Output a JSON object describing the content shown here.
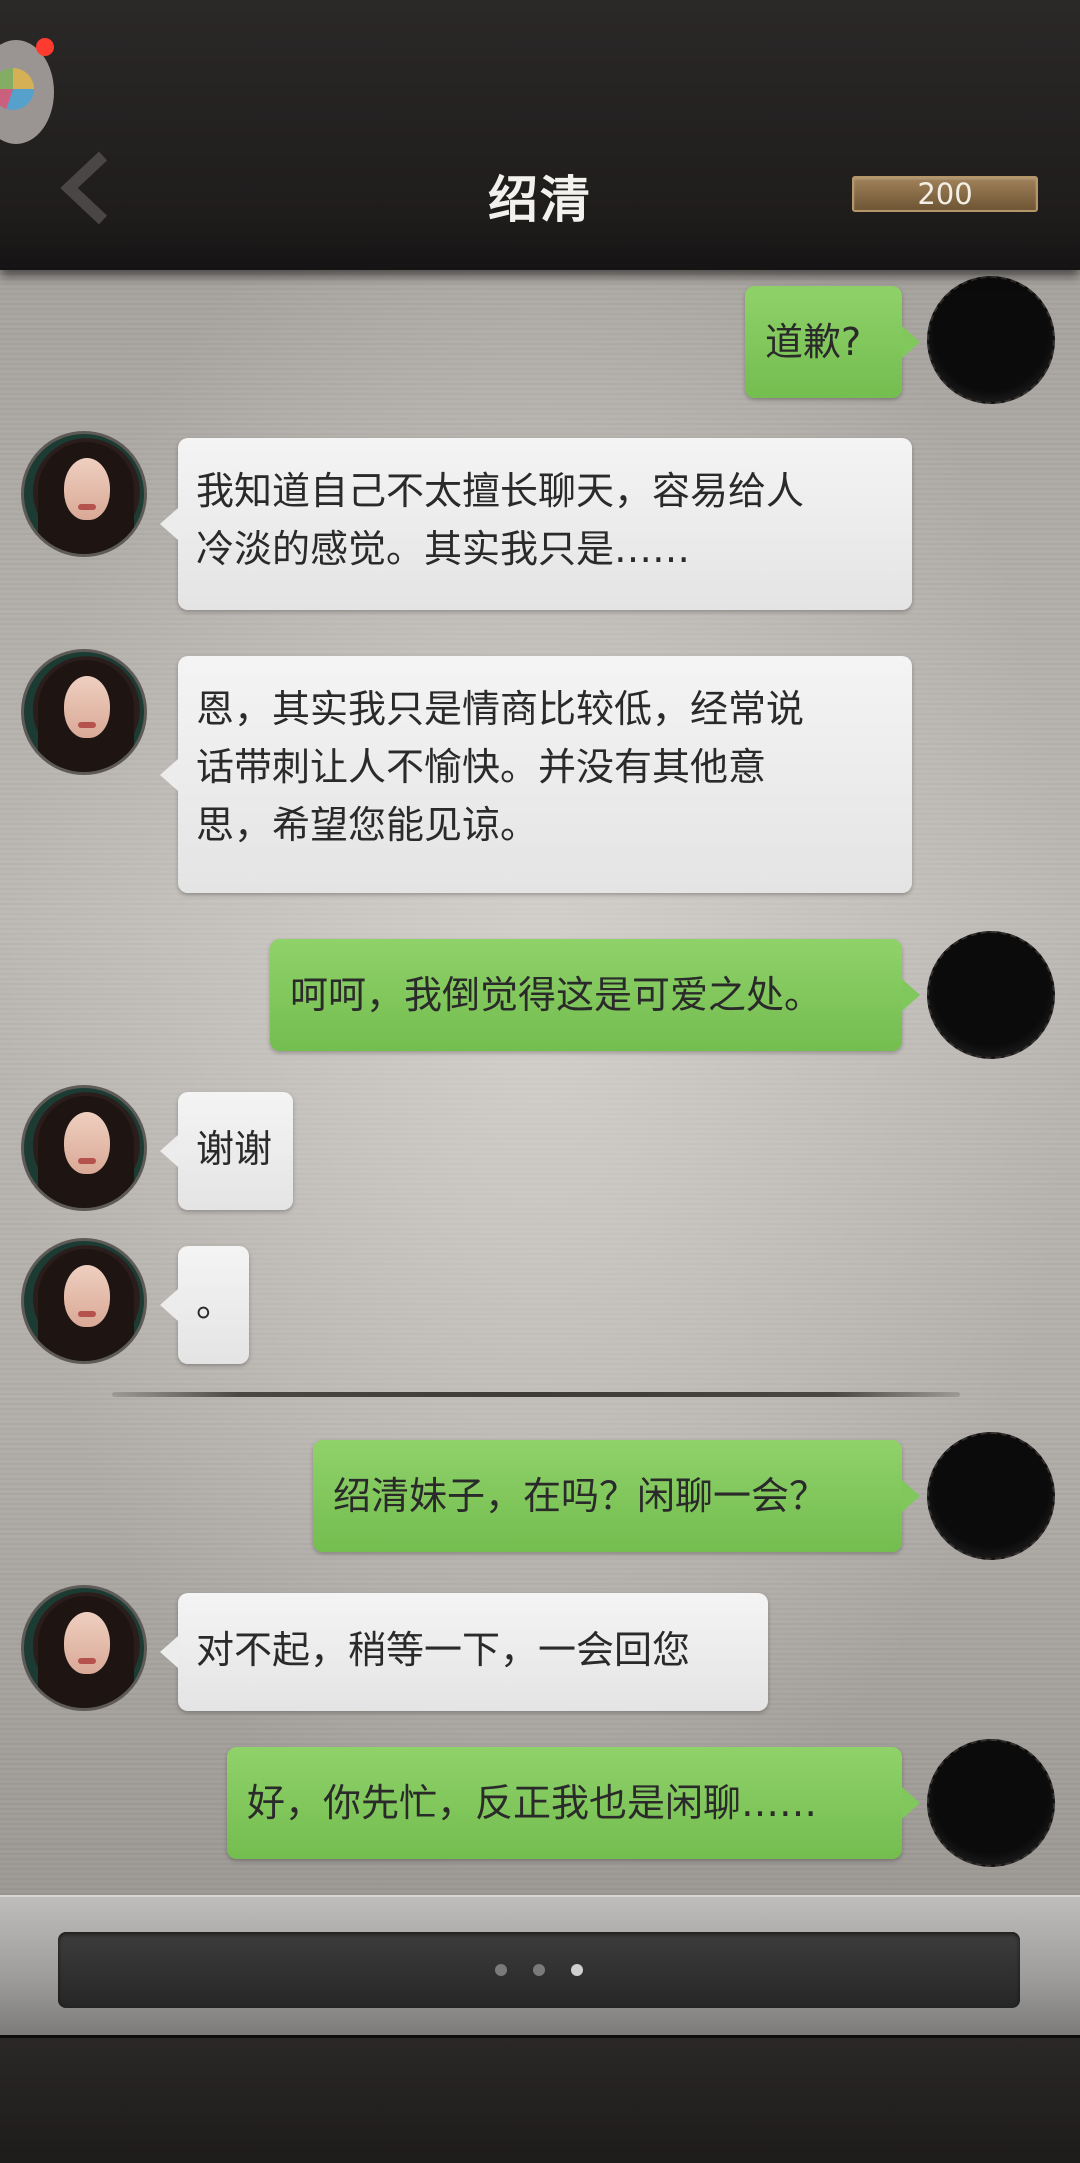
{
  "header": {
    "title": "绍清",
    "coins": "200",
    "back_icon": "chevron-left-icon"
  },
  "messages": [
    {
      "side": "right",
      "text": "道歉?"
    },
    {
      "side": "left",
      "lines": [
        "我知道自己不太擅长聊天，容易给人",
        "冷淡的感觉。其实我只是……"
      ]
    },
    {
      "side": "left",
      "lines": [
        "恩，其实我只是情商比较低，经常说",
        "话带刺让人不愉快。并没有其他意",
        "思，希望您能见谅。"
      ]
    },
    {
      "side": "right",
      "text": "呵呵，我倒觉得这是可爱之处。"
    },
    {
      "side": "left",
      "text": "谢谢"
    },
    {
      "side": "left",
      "text": "。"
    },
    {
      "side": "right",
      "text": "绍清妹子，在吗？闲聊一会？"
    },
    {
      "side": "left",
      "text": "对不起，稍等一下，一会回您"
    },
    {
      "side": "right",
      "text": "好，你先忙，反正我也是闲聊……"
    }
  ],
  "typing_indicator": {
    "dots": 3,
    "active_dot": 3
  },
  "colors": {
    "outgoing_bubble": "#7fc65a",
    "incoming_bubble": "#ececec",
    "header_bg": "#231f1f",
    "coin_badge": "#8a6d45",
    "notification_dot": "#ff3b30"
  }
}
